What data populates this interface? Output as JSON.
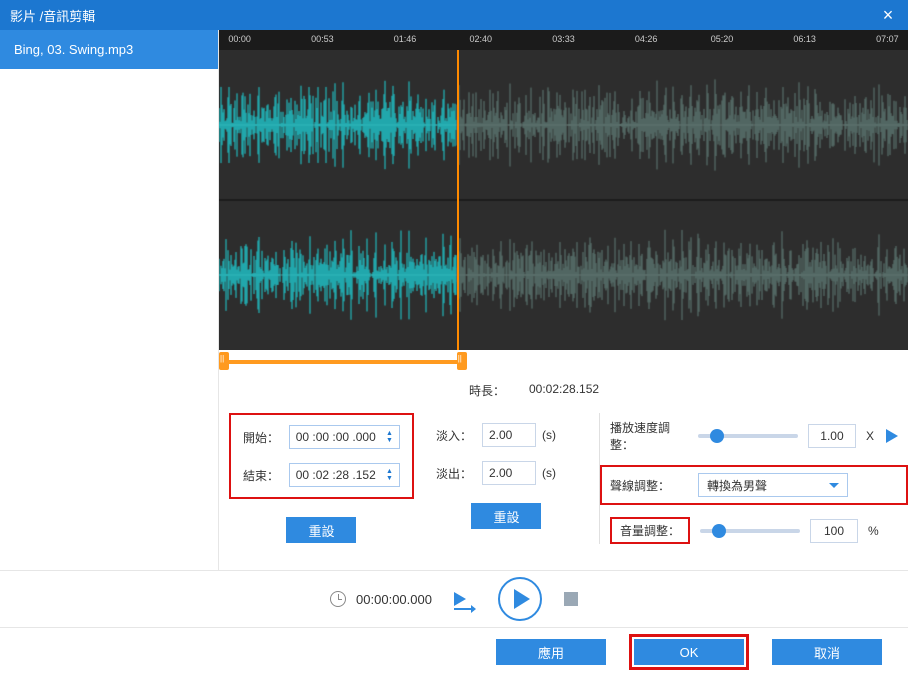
{
  "window": {
    "title": "影片 /音訊剪輯"
  },
  "sidebar": {
    "items": [
      {
        "label": "Bing, 03. Swing.mp3"
      }
    ]
  },
  "ruler": {
    "ticks": [
      "00:00",
      "00:53",
      "01:46",
      "02:40",
      "03:33",
      "04:26",
      "05:20",
      "06:13",
      "07:07"
    ]
  },
  "duration": {
    "label": "時長：",
    "value": "00:02:28.152"
  },
  "trim": {
    "start_label": "開始：",
    "start_value": "00 :00 :00 .000",
    "end_label": "結束：",
    "end_value": "00 :02 :28 .152",
    "reset_label": "重設"
  },
  "fade": {
    "in_label": "淡入：",
    "in_value": "2.00",
    "out_label": "淡出：",
    "out_value": "2.00",
    "unit": "(s)",
    "reset_label": "重設"
  },
  "speed": {
    "label": "播放速度調整：",
    "value": "1.00",
    "suffix": "X"
  },
  "voice": {
    "label": "聲線調整：",
    "selected": "轉換為男聲"
  },
  "volume": {
    "label": "音量調整：",
    "value": "100",
    "suffix": "%"
  },
  "transport": {
    "current": "00:00:00.000"
  },
  "footer": {
    "apply": "應用",
    "ok": "OK",
    "cancel": "取消"
  }
}
